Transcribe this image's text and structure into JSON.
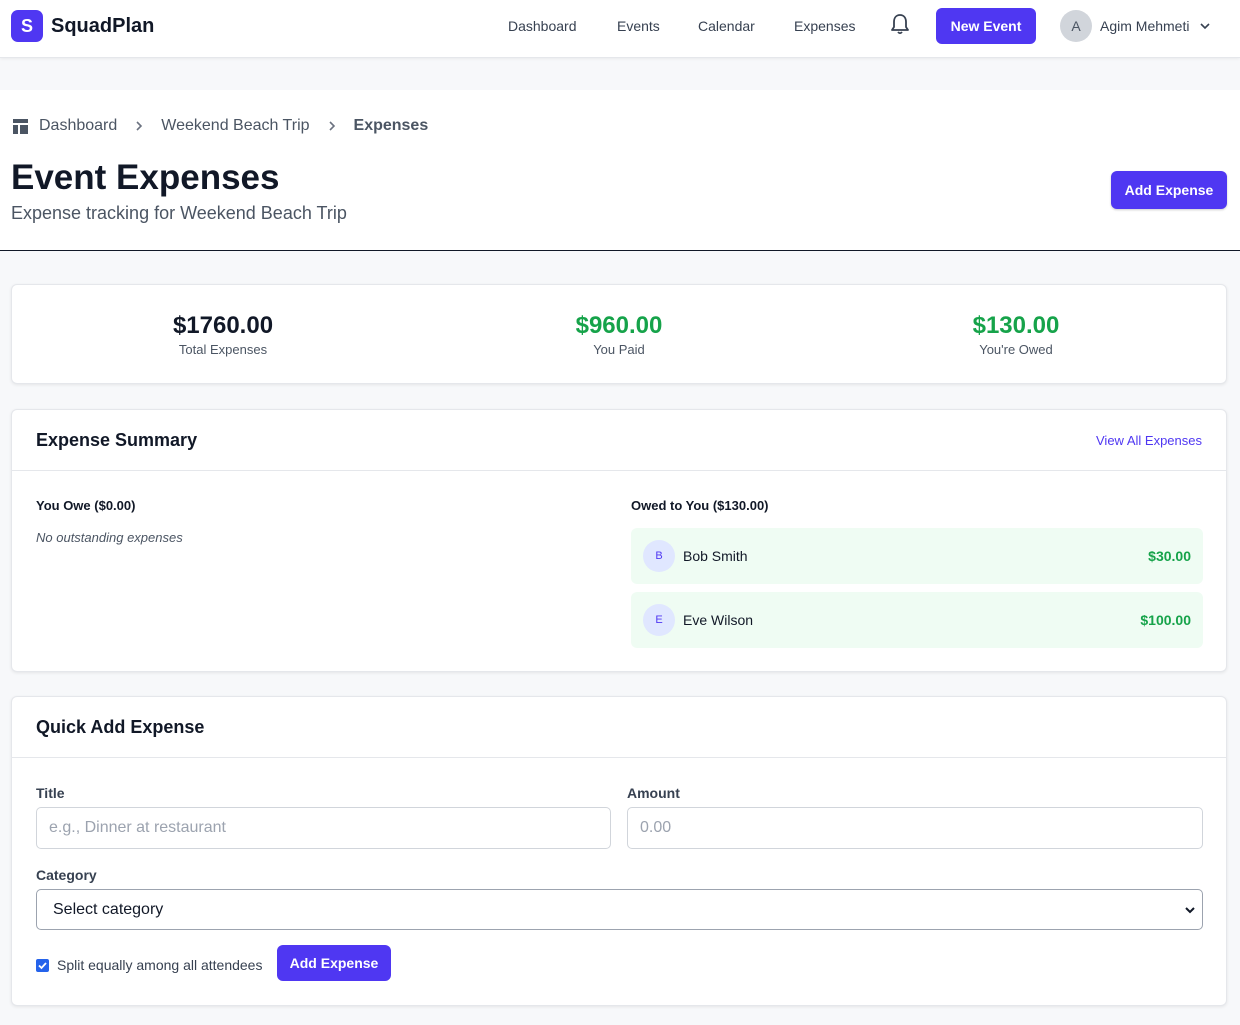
{
  "app": {
    "logo_letter": "S",
    "name": "SquadPlan"
  },
  "nav": {
    "links": [
      "Dashboard",
      "Events",
      "Calendar",
      "Expenses"
    ],
    "new_event_label": "New Event",
    "user": {
      "initial": "A",
      "name": "Agim Mehmeti"
    }
  },
  "breadcrumb": [
    "Dashboard",
    "Weekend Beach Trip",
    "Expenses"
  ],
  "page": {
    "title": "Event Expenses",
    "subtitle": "Expense tracking for Weekend Beach Trip",
    "add_expense_label": "Add Expense"
  },
  "stats": [
    {
      "value": "$1760.00",
      "label": "Total Expenses",
      "color": "#111827"
    },
    {
      "value": "$960.00",
      "label": "You Paid",
      "color": "#16a34a"
    },
    {
      "value": "$130.00",
      "label": "You're Owed",
      "color": "#16a34a"
    }
  ],
  "summary": {
    "title": "Expense Summary",
    "view_all_label": "View All Expenses",
    "you_owe_title": "You Owe ($0.00)",
    "no_outstanding": "No outstanding expenses",
    "owed_to_you_title": "Owed to You ($130.00)",
    "owed_to_you": [
      {
        "initial": "B",
        "name": "Bob Smith",
        "amount": "$30.00"
      },
      {
        "initial": "E",
        "name": "Eve Wilson",
        "amount": "$100.00"
      }
    ]
  },
  "quick_add": {
    "title": "Quick Add Expense",
    "title_label": "Title",
    "title_placeholder": "e.g., Dinner at restaurant",
    "amount_label": "Amount",
    "amount_placeholder": "0.00",
    "category_label": "Category",
    "category_value": "Select category",
    "split_label": "Split equally among all attendees",
    "split_checked": true,
    "submit_label": "Add Expense"
  },
  "colors": {
    "accent": "#4f37f2",
    "positive": "#16a34a",
    "owed_row_bg": "#effcf3"
  }
}
